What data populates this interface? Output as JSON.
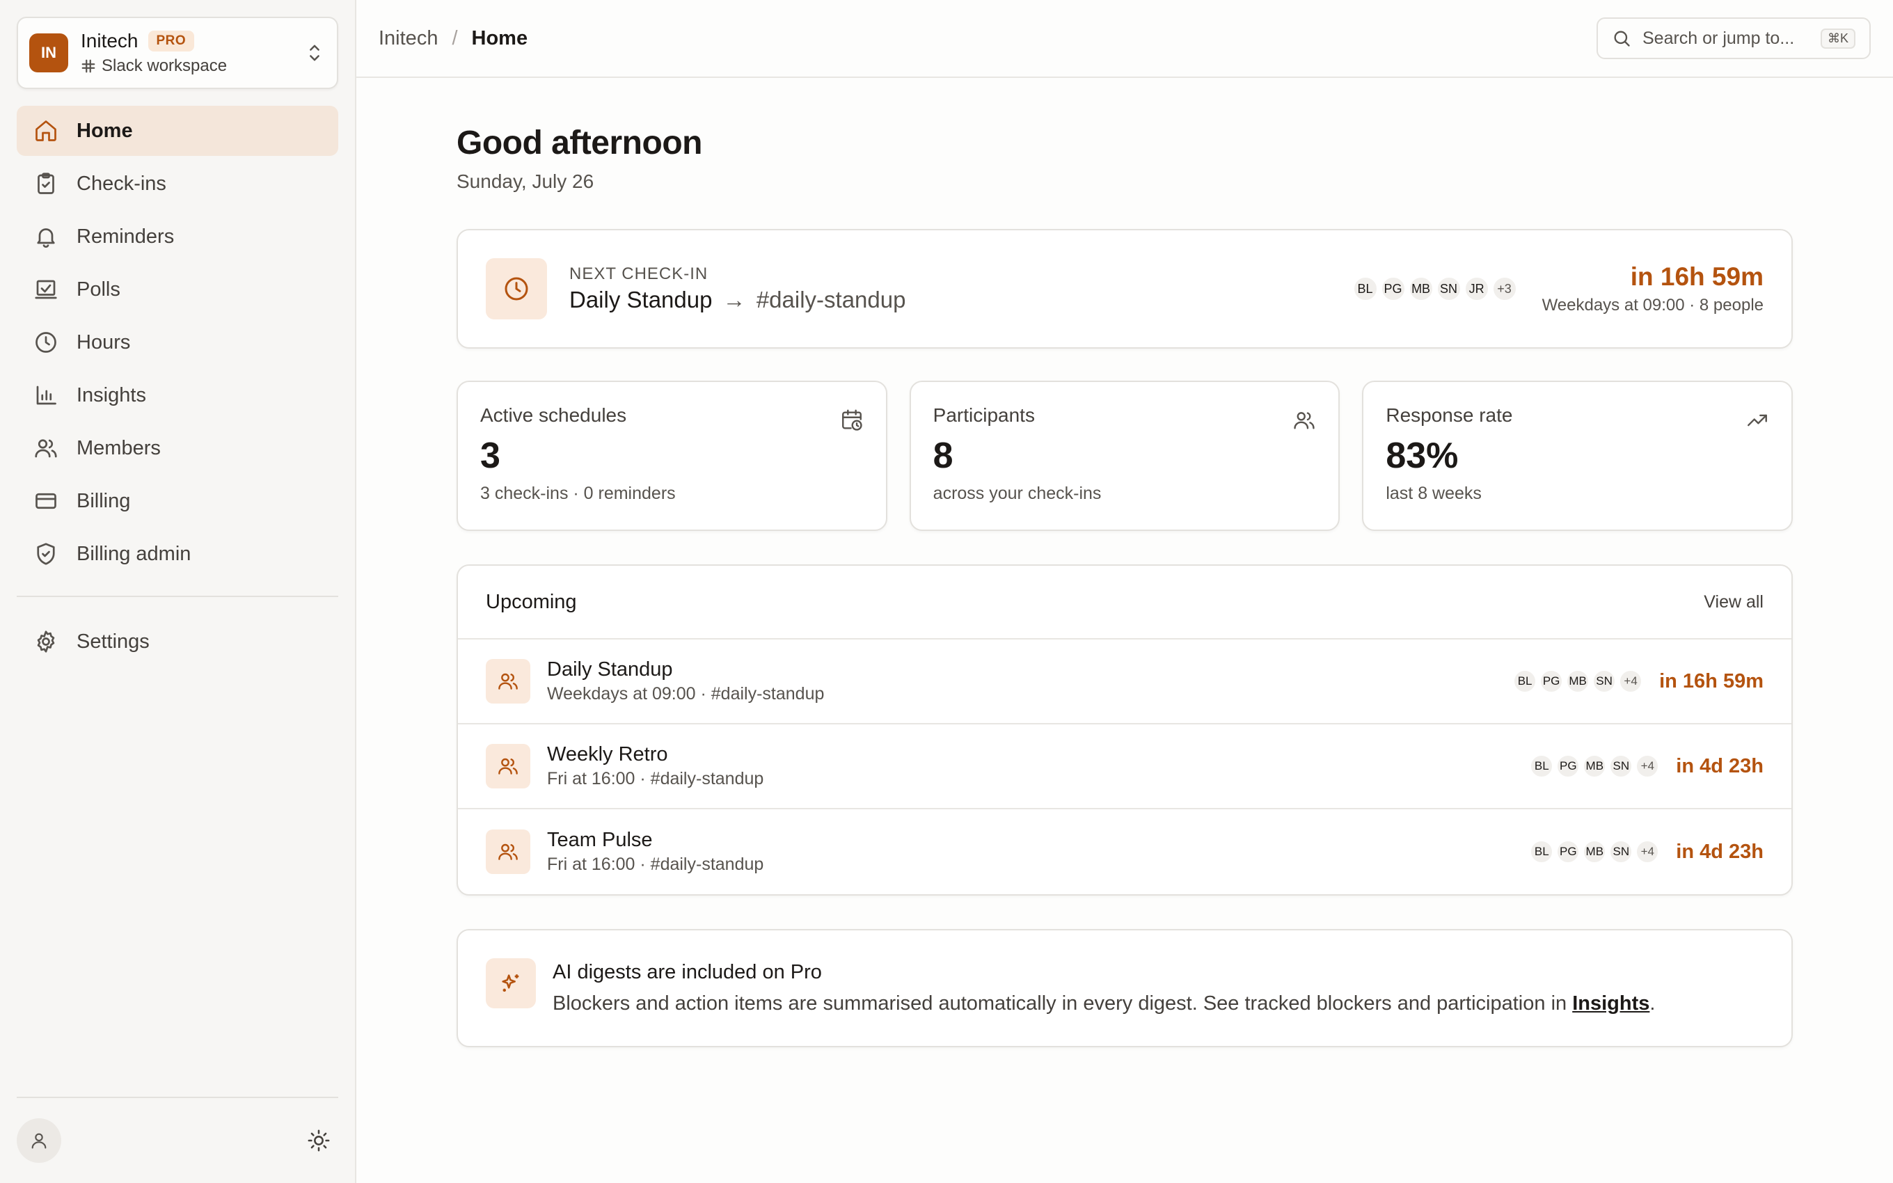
{
  "workspace": {
    "initials": "IN",
    "name": "Initech",
    "plan_badge": "PRO",
    "subtitle": "Slack workspace"
  },
  "sidebar": {
    "items": [
      {
        "label": "Home",
        "icon": "home-icon",
        "active": true
      },
      {
        "label": "Check-ins",
        "icon": "clipboard-check-icon"
      },
      {
        "label": "Reminders",
        "icon": "bell-icon"
      },
      {
        "label": "Polls",
        "icon": "poll-icon"
      },
      {
        "label": "Hours",
        "icon": "clock-icon"
      },
      {
        "label": "Insights",
        "icon": "bar-chart-icon"
      },
      {
        "label": "Members",
        "icon": "users-icon"
      },
      {
        "label": "Billing",
        "icon": "credit-card-icon"
      },
      {
        "label": "Billing admin",
        "icon": "shield-check-icon"
      }
    ],
    "settings_label": "Settings"
  },
  "header": {
    "breadcrumb_root": "Initech",
    "breadcrumb_sep": "/",
    "breadcrumb_current": "Home",
    "search_placeholder": "Search or jump to...",
    "search_shortcut": "⌘K"
  },
  "main": {
    "greeting": "Good afternoon",
    "date": "Sunday, July 26",
    "next_checkin": {
      "label": "NEXT CHECK-IN",
      "name": "Daily Standup",
      "arrow": "→",
      "channel": "#daily-standup",
      "avatars": [
        "BL",
        "PG",
        "MB",
        "SN",
        "JR"
      ],
      "more": "+3",
      "countdown": "in 16h 59m",
      "meta": "Weekdays at 09:00 · 8 people"
    },
    "stats": [
      {
        "label": "Active schedules",
        "value": "3",
        "sub": "3 check-ins · 0 reminders",
        "icon": "calendar-clock-icon"
      },
      {
        "label": "Participants",
        "value": "8",
        "sub": "across your check-ins",
        "icon": "users-icon"
      },
      {
        "label": "Response rate",
        "value": "83%",
        "sub": "last 8 weeks",
        "icon": "trending-up-icon"
      }
    ],
    "upcoming": {
      "title": "Upcoming",
      "view_all": "View all",
      "rows": [
        {
          "name": "Daily Standup",
          "meta": "Weekdays at 09:00 · #daily-standup",
          "avatars": [
            "BL",
            "PG",
            "MB",
            "SN"
          ],
          "more": "+4",
          "countdown": "in 16h 59m"
        },
        {
          "name": "Weekly Retro",
          "meta": "Fri at 16:00 · #daily-standup",
          "avatars": [
            "BL",
            "PG",
            "MB",
            "SN"
          ],
          "more": "+4",
          "countdown": "in 4d 23h"
        },
        {
          "name": "Team Pulse",
          "meta": "Fri at 16:00 · #daily-standup",
          "avatars": [
            "BL",
            "PG",
            "MB",
            "SN"
          ],
          "more": "+4",
          "countdown": "in 4d 23h"
        }
      ]
    },
    "ai": {
      "title": "AI digests are included on Pro",
      "body": "Blockers and action items are summarised automatically in every digest. See tracked blockers and participation in ",
      "link": "Insights",
      "end": "."
    }
  },
  "colors": {
    "accent": "#b4530f",
    "accent_soft": "#fae9dc",
    "active_nav_bg": "#f4e6da"
  }
}
